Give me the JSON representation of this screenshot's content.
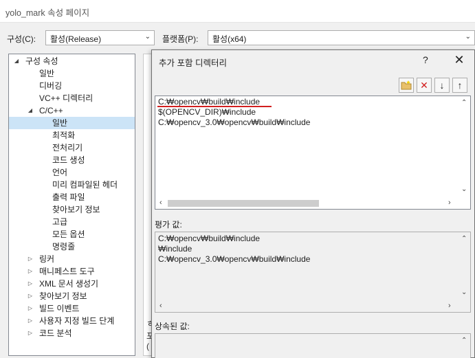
{
  "window": {
    "title": "yolo_mark 속성 페이지"
  },
  "config": {
    "config_label": "구성(C):",
    "config_value": "활성(Release)",
    "platform_label": "플랫폼(P):",
    "platform_value": "활성(x64)"
  },
  "tree": {
    "root": "구성 속성",
    "items": {
      "general": "일반",
      "debugging": "디버깅",
      "vc_dirs": "VC++ 디렉터리",
      "cpp": "C/C++",
      "cpp_general": "일반",
      "optimization": "최적화",
      "preprocessor": "전처리기",
      "code_gen": "코드 생성",
      "language": "언어",
      "precompiled": "미리 컴파일된 헤더",
      "output_files": "출력 파일",
      "browse_info": "찾아보기 정보",
      "advanced": "고급",
      "all_options": "모든 옵션",
      "command_line": "명령줄",
      "linker": "링커",
      "manifest": "매니페스트 도구",
      "xml_doc": "XML 문서 생성기",
      "browse_info2": "찾아보기 정보",
      "build_events": "빌드 이벤트",
      "custom_build": "사용자 지정 빌드 단계",
      "code_analysis": "코드 분석"
    }
  },
  "background": {
    "snip1": "ㅎ",
    "snip2": "포",
    "snip3": "("
  },
  "dialog": {
    "title": "추가 포함 디렉터리",
    "help": "?",
    "close": "✕",
    "toolbar": {
      "new_line": "📁",
      "delete": "✕",
      "move_down": "↓",
      "move_up": "↑"
    },
    "entries": [
      "C:₩opencv₩build₩include",
      "$(OPENCV_DIR)₩include",
      "C:₩opencv_3.0₩opencv₩build₩include"
    ],
    "evaluated_label": "평가 값:",
    "evaluated": [
      "C:₩opencv₩build₩include",
      "₩include",
      "C:₩opencv_3.0₩opencv₩build₩include"
    ],
    "inherited_label": "상속된 값:"
  },
  "colors": {
    "selection": "#cce4f7",
    "underline": "#d21e1e",
    "delete_icon": "#d21e1e"
  }
}
